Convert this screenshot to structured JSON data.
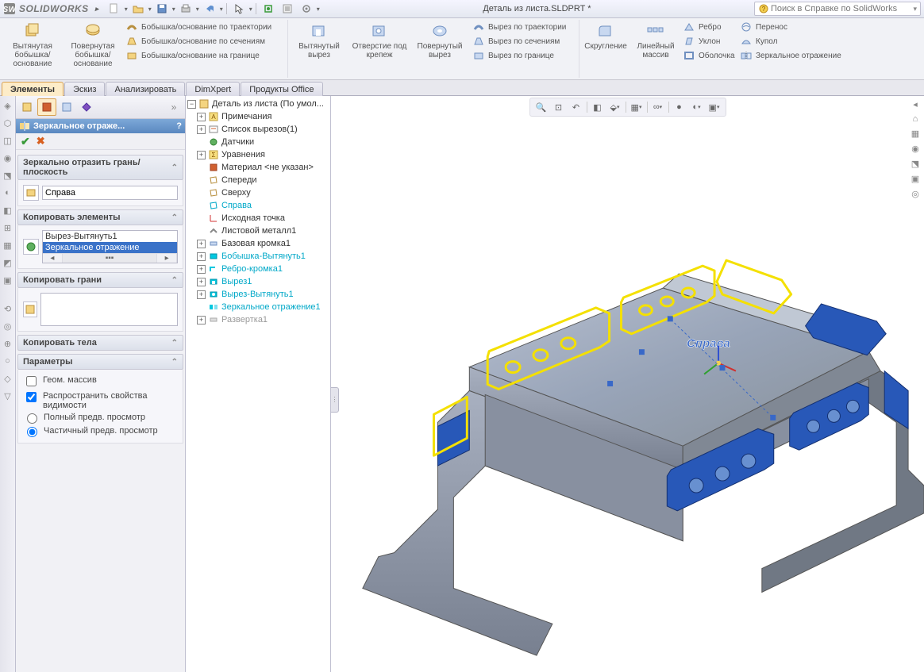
{
  "app": {
    "name": "SOLIDWORKS",
    "doc_title": "Деталь из листа.SLDPRT *",
    "search_placeholder": "Поиск в Справке по SolidWorks"
  },
  "ribbon": {
    "big1": "Вытянутая бобышка/основание",
    "big2": "Повернутая бобышка/основание",
    "l1a": "Бобышка/основание по траектории",
    "l1b": "Бобышка/основание по сечениям",
    "l1c": "Бобышка/основание на границе",
    "big3": "Вытянутый вырез",
    "big4": "Отверстие под крепеж",
    "big5": "Повернутый вырез",
    "l2a": "Вырез по траектории",
    "l2b": "Вырез по сечениям",
    "l2c": "Вырез по границе",
    "big6": "Скругление",
    "big7": "Линейный массив",
    "l3a": "Ребро",
    "l3b": "Уклон",
    "l3c": "Оболочка",
    "l4a": "Перенос",
    "l4b": "Купол",
    "l4c": "Зеркальное отражение"
  },
  "tabs": {
    "t1": "Элементы",
    "t2": "Эскиз",
    "t3": "Анализировать",
    "t4": "DimXpert",
    "t5": "Продукты Office"
  },
  "pm": {
    "title": "Зеркальное отраже...",
    "sec1": "Зеркально отразить грань/плоскость",
    "plane": "Справа",
    "sec2": "Копировать элементы",
    "item1": "Вырез-Вытянуть1",
    "item2": "Зеркальное отражение",
    "sec3": "Копировать грани",
    "sec4": "Копировать тела",
    "sec5": "Параметры",
    "opt1": "Геом. массив",
    "opt2": "Распространить свойства видимости",
    "opt3": "Полный предв. просмотр",
    "opt4": "Частичный предв. просмотр"
  },
  "tree": {
    "root": "Деталь из листа  (По умол...",
    "t1": "Примечания",
    "t2": "Список вырезов(1)",
    "t3": "Датчики",
    "t4": "Уравнения",
    "t5": "Материал <не указан>",
    "t6": "Спереди",
    "t7": "Сверху",
    "t8": "Справа",
    "t9": "Исходная точка",
    "t10": "Листовой металл1",
    "t11": "Базовая кромка1",
    "t12": "Бобышка-Вытянуть1",
    "t13": "Ребро-кромка1",
    "t14": "Вырез1",
    "t15": "Вырез-Вытянуть1",
    "t16": "Зеркальное отражение1",
    "t17": "Развертка1"
  },
  "viewport": {
    "plane_label": "Справа"
  }
}
